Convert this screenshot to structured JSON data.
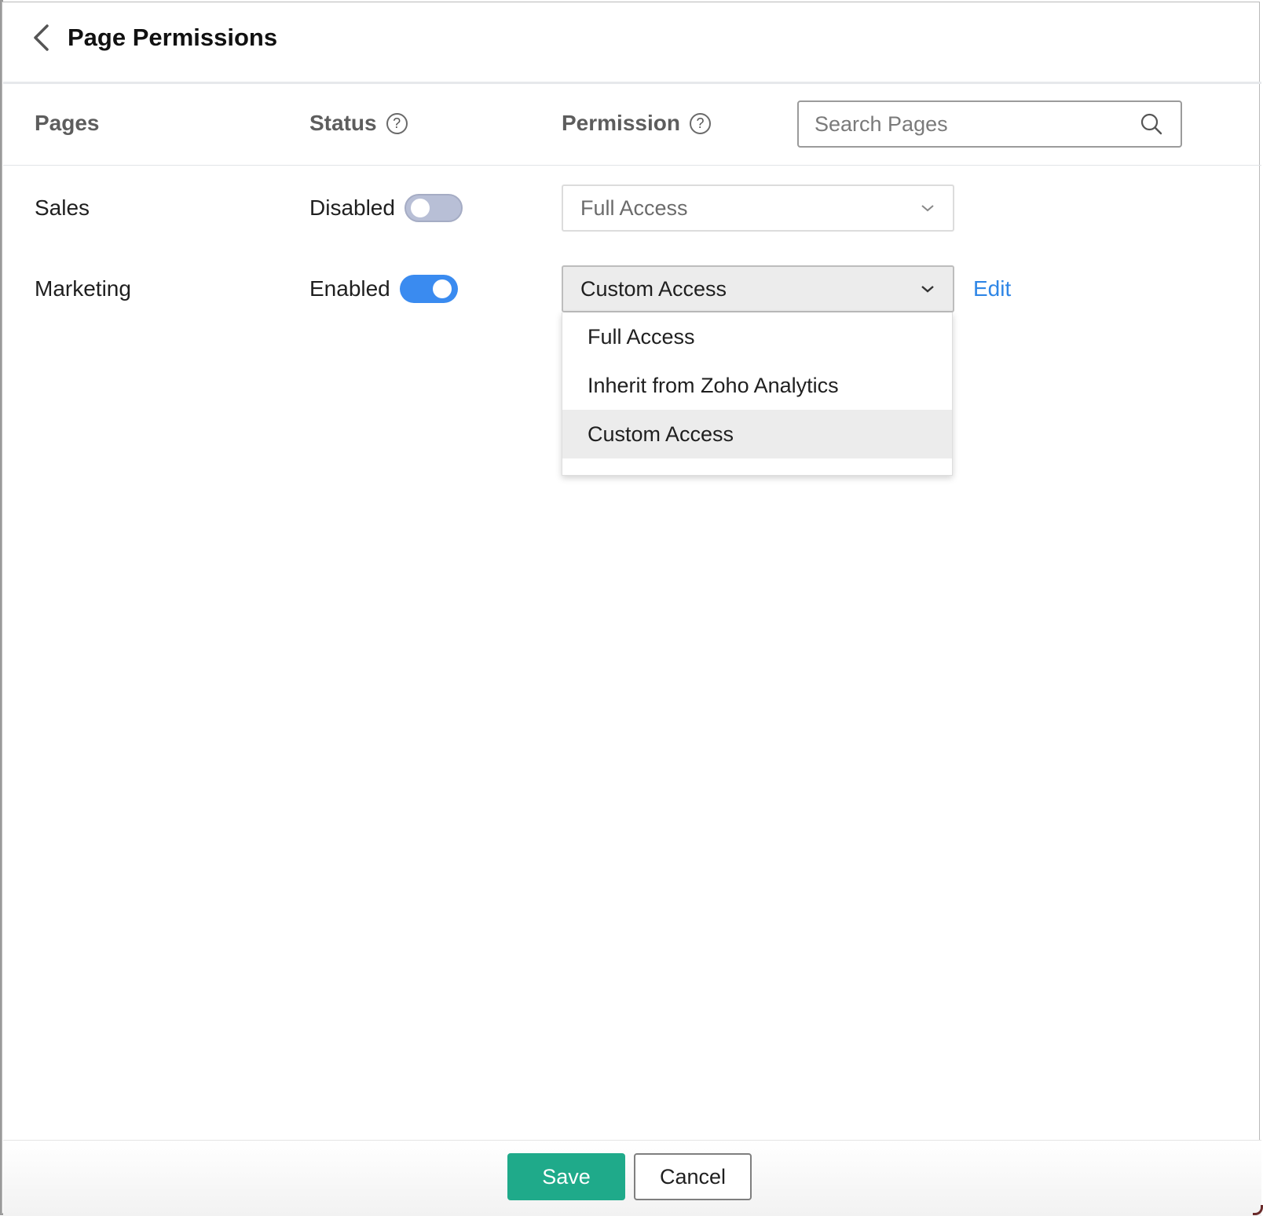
{
  "header": {
    "title": "Page Permissions"
  },
  "columns": {
    "pages": "Pages",
    "status": "Status",
    "permission": "Permission"
  },
  "search": {
    "placeholder": "Search Pages"
  },
  "rows": [
    {
      "page": "Sales",
      "status": "Disabled",
      "enabled": false,
      "permission": "Full Access"
    },
    {
      "page": "Marketing",
      "status": "Enabled",
      "enabled": true,
      "permission": "Custom Access",
      "edit_label": "Edit"
    }
  ],
  "dropdown": {
    "options": [
      "Full Access",
      "Inherit from Zoho Analytics",
      "Custom Access"
    ],
    "selected": "Custom Access"
  },
  "footer": {
    "save_label": "Save",
    "cancel_label": "Cancel"
  },
  "colors": {
    "accent_blue": "#3a8bf0",
    "save_green": "#1faa8a",
    "link_blue": "#2f86e6"
  }
}
